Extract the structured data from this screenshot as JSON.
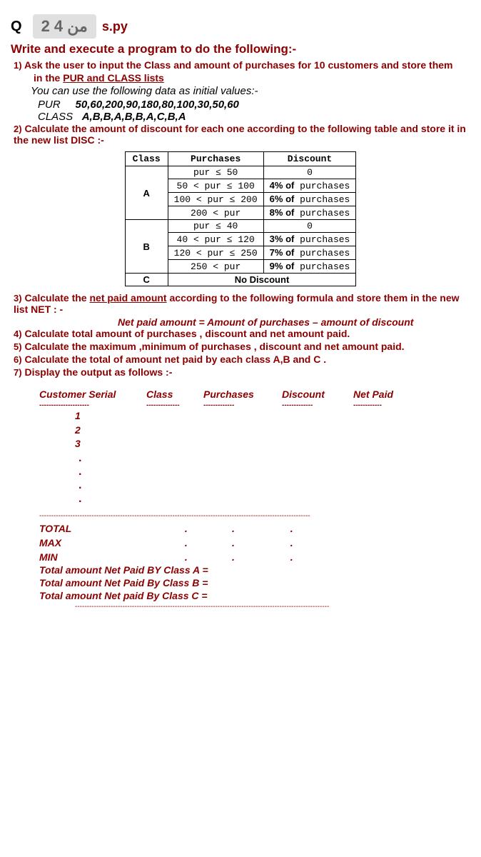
{
  "header": {
    "page_badge": "2 من 4",
    "q": "Q",
    "py": "s.py"
  },
  "title": "Write and execute a program to do the following:-",
  "items": {
    "i1_num": "1)",
    "i1_text": "Ask the user to input the Class and amount of purchases for 10 customers and store them",
    "i1_sub": "in the ",
    "i1_underline": "PUR and CLASS  lists",
    "initial_label": "You can use the following data as initial values:-",
    "pur_label": "PUR",
    "pur_values": "50,60,200,90,180,80,100,30,50,60",
    "class_label": "CLASS",
    "class_values": "A,B,B,A,B,B,A,C,B,A",
    "i2_num": "2)",
    "i2_text": "Calculate the amount of discount for each one according to the following table and store it in the new list DISC :-",
    "i3_num": "3)",
    "i3_text": "Calculate the ",
    "i3_underline": "net paid amount",
    "i3_text2": " according to the following formula and store them in the new list NET : -",
    "formula": "Net paid amount =  Amount of purchases – amount of discount",
    "i4_num": "4)",
    "i4_text": "Calculate total amount of purchases , discount and net amount paid.",
    "i5_num": "5)",
    "i5_text": "Calculate the maximum ,minimum  of purchases , discount and net amount paid.",
    "i6_num": "6)",
    "i6_text": "Calculate the total of amount net paid by each class A,B and C .",
    "i7_num": "7)",
    "i7_text": "Display the output as follows :-"
  },
  "table": {
    "headers": {
      "class": "Class",
      "purchases": "Purchases",
      "discount": "Discount"
    },
    "rows": [
      {
        "class": "A",
        "pur": "pur ≤ 50",
        "disc": "0"
      },
      {
        "class": "",
        "pur": "50 <  pur ≤ 100",
        "disc_pct": "4% of",
        "disc_txt": " purchases"
      },
      {
        "class": "",
        "pur": "100 <  pur ≤ 200",
        "disc_pct": "6% of",
        "disc_txt": " purchases"
      },
      {
        "class": "",
        "pur": "200 <  pur",
        "disc_pct": "8% of",
        "disc_txt": " purchases"
      },
      {
        "class": "B",
        "pur": "pur ≤ 40",
        "disc": "0"
      },
      {
        "class": "",
        "pur": "40 <  pur ≤ 120",
        "disc_pct": "3% of",
        "disc_txt": " purchases"
      },
      {
        "class": "",
        "pur": "120 <  pur ≤ 250",
        "disc_pct": "7% of",
        "disc_txt": " purchases"
      },
      {
        "class": "",
        "pur": "250 <  pur",
        "disc_pct": "9% of",
        "disc_txt": " purchases"
      },
      {
        "class": "C",
        "no_discount": "No Discount"
      }
    ]
  },
  "output": {
    "h1": "Customer Serial",
    "h2": "Class",
    "h3": "Purchases",
    "h4": "Discount",
    "h5": "Net Paid",
    "s1": "1",
    "s2": "2",
    "s3": "3",
    "total": "TOTAL",
    "max": "MAX",
    "min": "MIN",
    "ta": "Total amount Net Paid BY Class A =",
    "tb": "Total amount Net Paid By Class B  =",
    "tc": "Total amount Net paid By Class C  ="
  }
}
